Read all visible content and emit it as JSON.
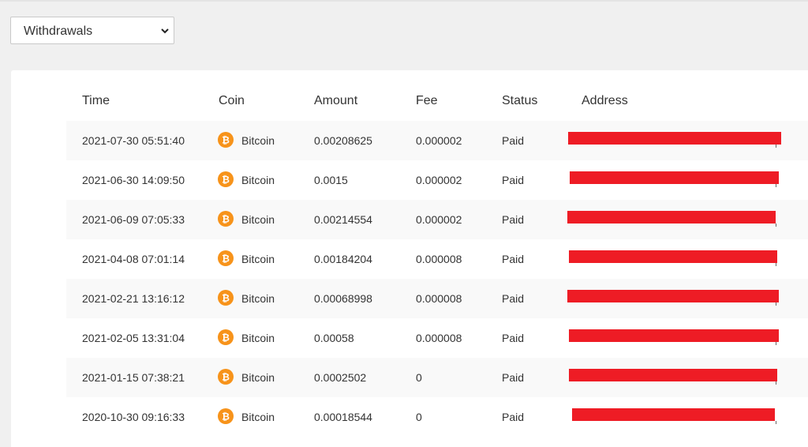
{
  "filter": {
    "selected": "Withdrawals"
  },
  "table": {
    "headers": [
      "Time",
      "Coin",
      "Amount",
      "Fee",
      "Status",
      "Address"
    ],
    "rows": [
      {
        "time": "2021-07-30 05:51:40",
        "coin": "Bitcoin",
        "amount": "0.00208625",
        "fee": "0.000002",
        "status": "Paid"
      },
      {
        "time": "2021-06-30 14:09:50",
        "coin": "Bitcoin",
        "amount": "0.0015",
        "fee": "0.000002",
        "status": "Paid"
      },
      {
        "time": "2021-06-09 07:05:33",
        "coin": "Bitcoin",
        "amount": "0.00214554",
        "fee": "0.000002",
        "status": "Paid"
      },
      {
        "time": "2021-04-08 07:01:14",
        "coin": "Bitcoin",
        "amount": "0.00184204",
        "fee": "0.000008",
        "status": "Paid"
      },
      {
        "time": "2021-02-21 13:16:12",
        "coin": "Bitcoin",
        "amount": "0.00068998",
        "fee": "0.000008",
        "status": "Paid"
      },
      {
        "time": "2021-02-05 13:31:04",
        "coin": "Bitcoin",
        "amount": "0.00058",
        "fee": "0.000008",
        "status": "Paid"
      },
      {
        "time": "2021-01-15 07:38:21",
        "coin": "Bitcoin",
        "amount": "0.0002502",
        "fee": "0",
        "status": "Paid"
      },
      {
        "time": "2020-10-30 09:16:33",
        "coin": "Bitcoin",
        "amount": "0.00018544",
        "fee": "0",
        "status": "Paid"
      }
    ]
  },
  "icons": {
    "coin": "bitcoin-icon",
    "dropdown": "chevron-down-icon"
  },
  "colors": {
    "bitcoin": "#f7931a",
    "redaction": "#ee1c25",
    "row_stripe": "#f9f9f9"
  }
}
